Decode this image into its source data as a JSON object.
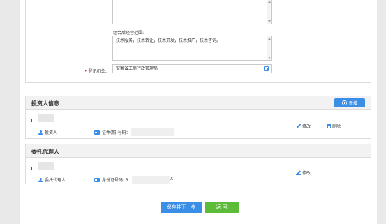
{
  "form": {
    "combined_scope_label": "组合后经营范围:",
    "combined_scope_value": "技术服务，技术转让，技术开发，技术推广，技术咨询。",
    "registration_authority_label": "登记机关：",
    "registration_authority_value": "安徽省工商行政管理局"
  },
  "investor_section": {
    "title": "投资人信息",
    "add_label": "新增",
    "record": {
      "type_label": "投资人",
      "id_label": "证件(照)号码：",
      "edit_label": "修改",
      "delete_label": "删除"
    }
  },
  "agent_section": {
    "title": "委托代理人",
    "record": {
      "type_label": "委托代理人",
      "id_label": "身份证号码: 3",
      "id_suffix": "X",
      "edit_label": "修改"
    }
  },
  "actions": {
    "save_next_label": "保存并下一步",
    "back_label": "返 回"
  },
  "colors": {
    "primary": "#3a8ee6",
    "back_button": "#5dbb3a",
    "required": "#e33333"
  }
}
